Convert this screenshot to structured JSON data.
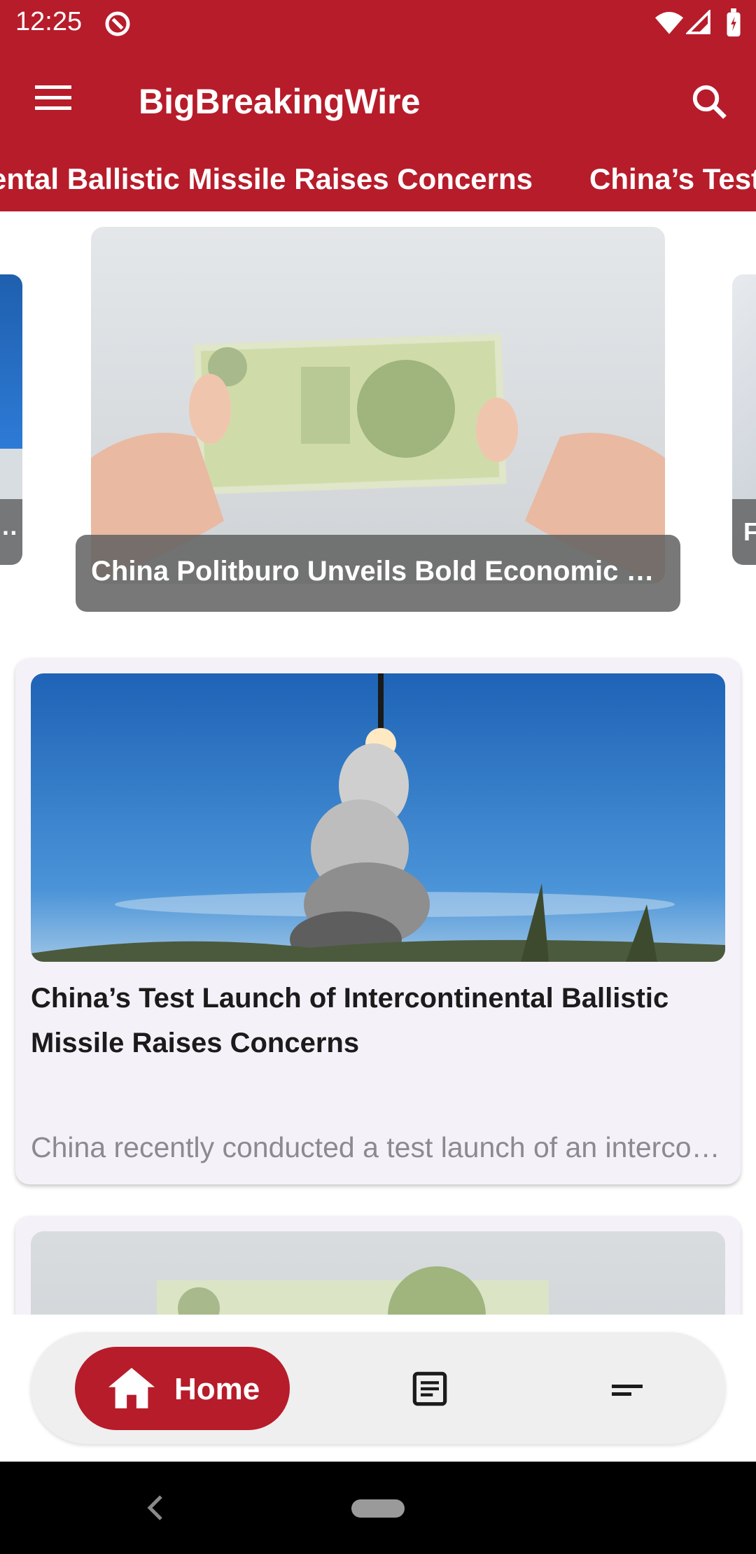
{
  "status_bar": {
    "time": "12:25"
  },
  "app_bar": {
    "title": "BigBreakingWire"
  },
  "ticker": [
    "China’s Test Launch of Intercontinental Ballistic Missile Raises Concerns",
    "China’s Test"
  ],
  "carousel": {
    "left_caption": "…",
    "main_caption": "China Politburo Unveils Bold Economic Plan",
    "right_caption": "Fi"
  },
  "feed": [
    {
      "title": "China’s Test Launch of Intercontinental Ballistic Missile Raises Concerns",
      "excerpt": "China recently conducted a test launch of an intercontinental ballistic missile"
    },
    {
      "title": "",
      "excerpt": ""
    }
  ],
  "bottom_nav": {
    "home_label": "Home"
  },
  "colors": {
    "brand": "#b71c2a",
    "card_bg": "#f5f1f8"
  }
}
